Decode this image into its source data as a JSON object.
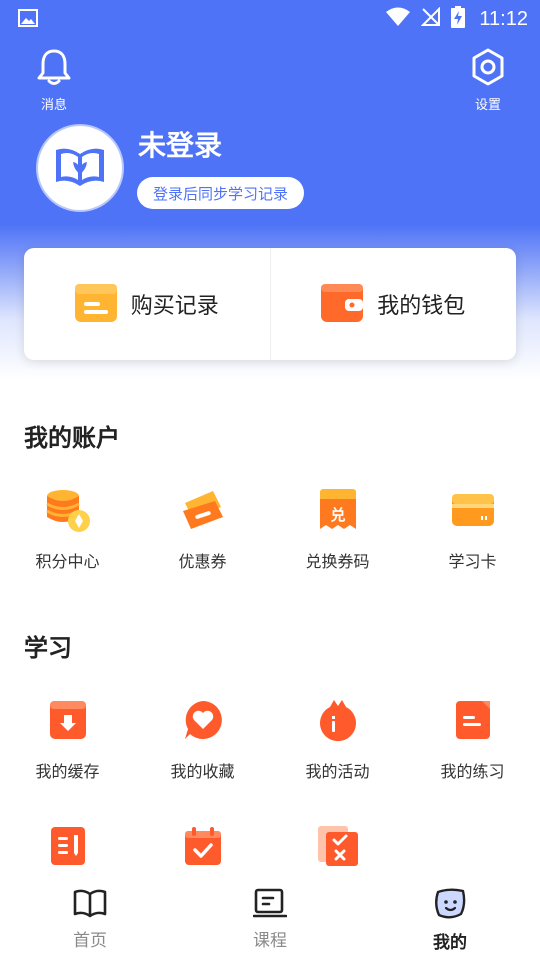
{
  "status_bar": {
    "time": "11:12"
  },
  "header": {
    "messages_label": "消息",
    "settings_label": "设置",
    "username": "未登录",
    "login_hint": "登录后同步学习记录"
  },
  "quick_card": {
    "purchase_label": "购买记录",
    "wallet_label": "我的钱包"
  },
  "account": {
    "title": "我的账户",
    "items": [
      {
        "label": "积分中心",
        "icon": "points-coins-icon"
      },
      {
        "label": "优惠券",
        "icon": "coupon-icon"
      },
      {
        "label": "兑换券码",
        "icon": "redeem-code-icon"
      },
      {
        "label": "学习卡",
        "icon": "study-card-icon"
      }
    ]
  },
  "study": {
    "title": "学习",
    "items": [
      {
        "label": "我的缓存",
        "icon": "download-cache-icon"
      },
      {
        "label": "我的收藏",
        "icon": "favorite-heart-icon"
      },
      {
        "label": "我的活动",
        "icon": "activity-icon"
      },
      {
        "label": "我的练习",
        "icon": "practice-icon"
      },
      {
        "label": "",
        "icon": "notes-icon"
      },
      {
        "label": "",
        "icon": "check-calendar-icon"
      },
      {
        "label": "",
        "icon": "wrong-questions-icon"
      }
    ]
  },
  "tabs": [
    {
      "label": "首页",
      "icon": "book-icon",
      "active": false
    },
    {
      "label": "课程",
      "icon": "course-icon",
      "active": false
    },
    {
      "label": "我的",
      "icon": "face-icon",
      "active": true
    }
  ],
  "colors": {
    "primary": "#4f73f7",
    "accent_orange": "#ff6a2b",
    "accent_yellow": "#ffb432"
  }
}
